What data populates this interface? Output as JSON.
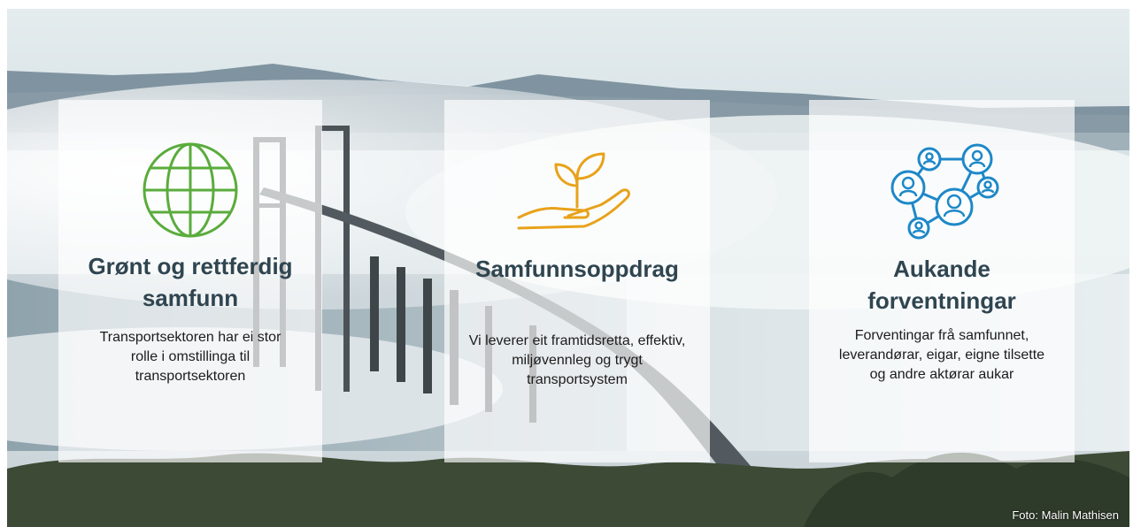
{
  "cards": [
    {
      "icon": "globe-icon",
      "icon_color": "#5aac3c",
      "title": "Grønt og rettferdig samfunn",
      "body": "Transportsektoren har ei stor rolle i omstillinga til transportsektoren"
    },
    {
      "icon": "hand-sprout-icon",
      "icon_color": "#e8a21a",
      "title": "Samfunnsoppdrag",
      "body": "Vi leverer eit framtidsretta, effektiv, miljøvennleg og trygt transportsystem"
    },
    {
      "icon": "network-people-icon",
      "icon_color": "#1e88c8",
      "title": "Aukande forventningar",
      "body": "Forventingar frå samfunnet, leverandørar, eigar, eigne tilsette og andre aktørar aukar"
    }
  ],
  "photo_credit": "Foto: Malin Mathisen",
  "colors": {
    "title": "#2f4550",
    "card_background": "rgba(255,255,255,0.68)"
  }
}
